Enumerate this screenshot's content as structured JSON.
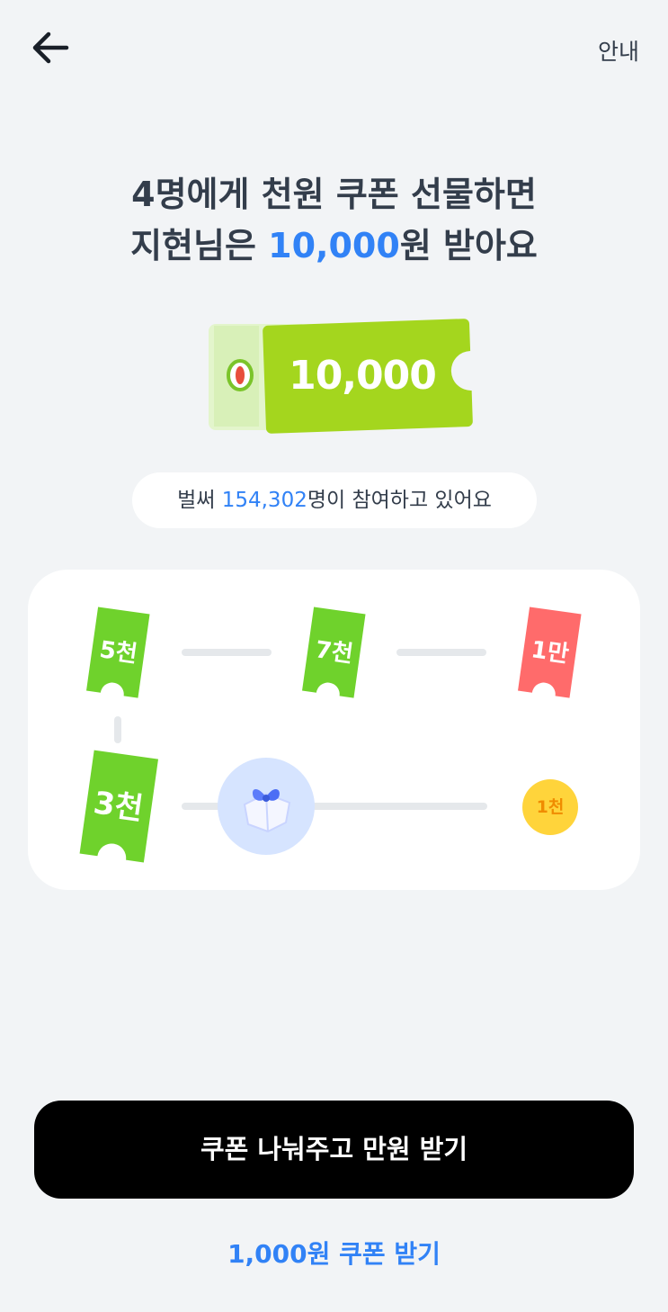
{
  "header": {
    "info_label": "안내"
  },
  "headline": {
    "line1": "4명에게 천원 쿠폰 선물하면",
    "line2_prefix": "지현님은 ",
    "line2_amount": "10,000",
    "line2_suffix": "원 받아요"
  },
  "coupon": {
    "amount": "10,000"
  },
  "participants": {
    "prefix": "벌써 ",
    "count": "154,302",
    "suffix": "명이 참여하고 있어요"
  },
  "progress": {
    "steps": [
      {
        "label": "3천"
      },
      {
        "label": "5천"
      },
      {
        "label": "7천"
      },
      {
        "label": "1만"
      },
      {
        "label": "1천"
      }
    ]
  },
  "actions": {
    "primary_label": "쿠폰 나눠주고 만원 받기",
    "secondary_label": "1,000원 쿠폰 받기"
  },
  "colors": {
    "accent": "#3182f6",
    "ticket_green": "#6fd22c",
    "ticket_red": "#ff6b6b",
    "coin_yellow": "#ffd43b"
  }
}
